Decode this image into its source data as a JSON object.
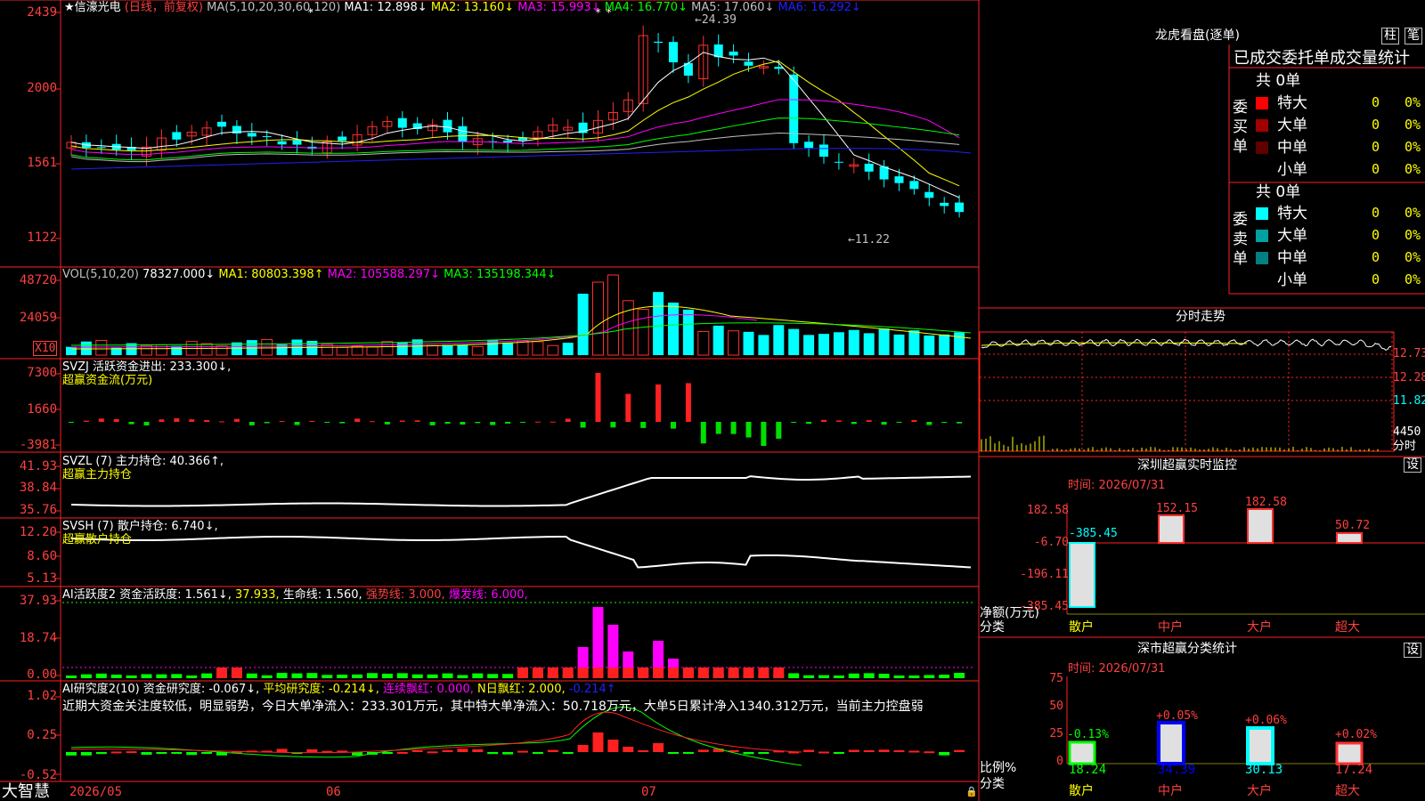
{
  "header": {
    "star": "★",
    "stock_name": "信濠光电",
    "period": "(日线，前复权)",
    "ma_label": "MA(5,10,20,30,60,120)",
    "ma": [
      {
        "label": "MA1: 12.898↓",
        "color": "#ffffff"
      },
      {
        "label": "MA2: 13.160↓",
        "color": "#ffff00"
      },
      {
        "label": "MA3: 15.993↓",
        "color": "#ff00ff"
      },
      {
        "label": "MA4: 16.770↓",
        "color": "#00ff00"
      },
      {
        "label": "MA5: 17.060↓",
        "color": "#c0c0c0"
      },
      {
        "label": "MA6: 16.292↓",
        "color": "#2020ff"
      }
    ]
  },
  "price_axis": [
    "2439",
    "2000",
    "1561",
    "1122"
  ],
  "price_marks": {
    "high": "24.39",
    "low": "11.22"
  },
  "vol": {
    "title": "VOL(5,10,20)",
    "value": "78327.000↓",
    "ma1": "MA1: 80803.398↑",
    "ma2": "MA2: 105588.297↓",
    "ma3": "MA3: 135198.344↓",
    "axis": [
      "48720",
      "24059"
    ],
    "unit": "X10"
  },
  "svzj": {
    "title": "SVZJ  活跃资金进出: 233.300↓,",
    "sub": "超赢资金流(万元)",
    "axis": [
      "7300",
      "1660",
      "-3981"
    ]
  },
  "svzl": {
    "title": "SVZL (7) 主力持仓: 40.366↑,",
    "sub": "超赢主力持仓",
    "axis": [
      "41.93",
      "38.84",
      "35.76"
    ]
  },
  "svsh": {
    "title": "SVSH (7) 散户持仓: 6.740↓,",
    "sub": "超赢散户持仓",
    "axis": [
      "12.20",
      "8.60",
      "5.13"
    ]
  },
  "ai1": {
    "title": "AI活跃度2 资金活跃度: 1.561↓,",
    "v2": "37.933,",
    "v3": "生命线: 1.560,",
    "v4": "强势线: 3.000,",
    "v5": "爆发线: 6.000,",
    "axis": [
      "37.93",
      "18.74",
      "0.00"
    ]
  },
  "ai2": {
    "title": "AI研究度2(10) 资金研究度: -0.067↓,",
    "v2": "平均研究度: -0.214↓,",
    "v3": "连续飘红: 0.000,",
    "v4": "N日飘红: 2.000,",
    "v5": "-0.214↑",
    "text": "近期大资金关注度较低，明显弱势，今日大单净流入：233.301万元，其中特大单净流入：50.718万元，大单5日累计净入1340.312万元，当前主力控盘弱",
    "axis": [
      "1.02",
      "0.25",
      "-0.52"
    ]
  },
  "bottom": {
    "logo": "大智慧",
    "dates": [
      "2026/05",
      "06",
      "07"
    ]
  },
  "right": {
    "title": "龙虎看盘(逐单)",
    "btn1": "柱",
    "btn2": "笔",
    "stat_title": "已成交委托单成交量统计",
    "buy_side": "委买单",
    "sell_side": "委卖单",
    "buy_total": "共 0单",
    "sell_total": "共 0单",
    "buy_rows": [
      {
        "label": "特大",
        "v": "0",
        "p": "0%",
        "c": "#ff0000"
      },
      {
        "label": "大单",
        "v": "0",
        "p": "0%",
        "c": "#a00000"
      },
      {
        "label": "中单",
        "v": "0",
        "p": "0%",
        "c": "#600000"
      },
      {
        "label": "小单",
        "v": "0",
        "p": "0%",
        "c": "#000000"
      }
    ],
    "sell_rows": [
      {
        "label": "特大",
        "v": "0",
        "p": "0%",
        "c": "#00ffff"
      },
      {
        "label": "大单",
        "v": "0",
        "p": "0%",
        "c": "#00a0a0"
      },
      {
        "label": "中单",
        "v": "0",
        "p": "0%",
        "c": "#008080"
      },
      {
        "label": "小单",
        "v": "0",
        "p": "0%",
        "c": "#000000"
      }
    ],
    "fenshi_title": "分时走势",
    "fenshi_axis": [
      "12.73",
      "12.28",
      "11.82"
    ],
    "fenshi_vol": "4450",
    "fenshi_unit": "分时",
    "monitor_title": "深圳超赢实时监控",
    "set": "设",
    "monitor_time": "时间: 2026/07/31",
    "monitor_axis": [
      "182.58",
      "-6.70",
      "-196.11",
      "-385.45"
    ],
    "monitor_ylabel1": "净额(万元)",
    "monitor_ylabel2": "分类",
    "monitor_values": [
      "-385.45",
      "152.15",
      "182.58",
      "50.72"
    ],
    "categories": [
      "散户",
      "中户",
      "大户",
      "超大"
    ],
    "stat2_title": "深市超赢分类统计",
    "stat2_time": "时间: 2026/07/31",
    "stat2_axis": [
      "75",
      "50",
      "25",
      "0"
    ],
    "stat2_pct": [
      "-0.13%",
      "+0.05%",
      "+0.06%",
      "+0.02%"
    ],
    "stat2_values": [
      "18.24",
      "34.39",
      "30.13",
      "17.24"
    ],
    "stat2_ylabel1": "比例%",
    "stat2_ylabel2": "分类"
  }
}
